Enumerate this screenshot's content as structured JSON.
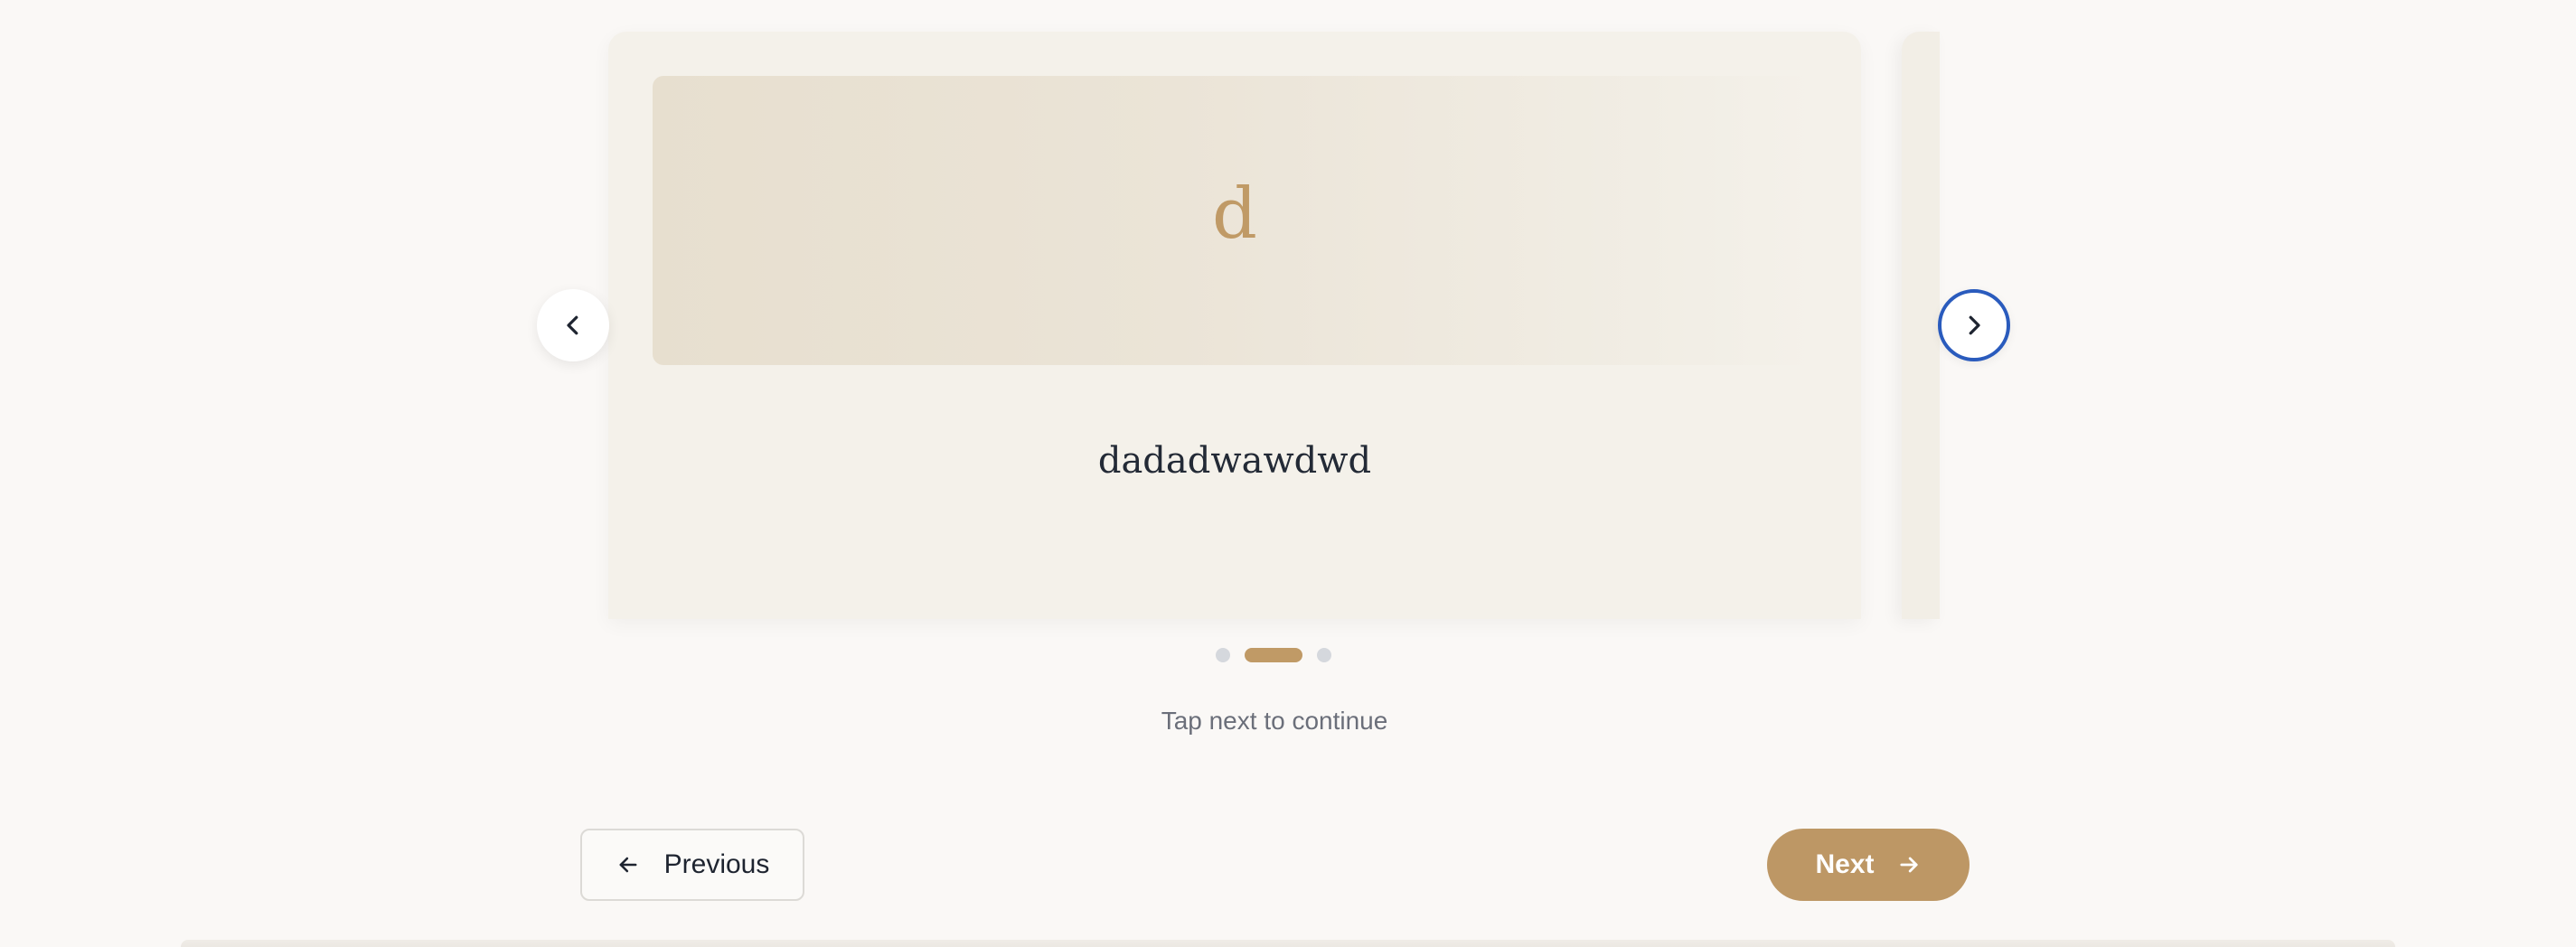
{
  "card": {
    "letter": "d",
    "title": "dadadwawdwd"
  },
  "carousel": {
    "slide_count": 3,
    "active_index": 1
  },
  "hint": "Tap next to continue",
  "nav": {
    "previous_label": "Previous",
    "next_label": "Next"
  },
  "icons": {
    "carousel_prev": "chevron-left-icon",
    "carousel_next": "chevron-right-icon",
    "previous": "arrow-left-icon",
    "next": "arrow-right-icon"
  },
  "colors": {
    "accent": "#bd9765",
    "focus_ring": "#2a5bbd",
    "card_bg": "#f4f1ea",
    "page_bg": "#faf8f6"
  }
}
